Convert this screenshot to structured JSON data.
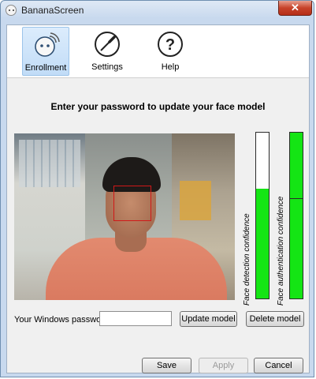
{
  "window": {
    "title": "BananaScreen",
    "close_glyph": "✕"
  },
  "toolbar": {
    "items": [
      {
        "label": "Enrollment",
        "icon": "enrollment-face-icon",
        "active": true
      },
      {
        "label": "Settings",
        "icon": "screwdriver-icon",
        "active": false
      },
      {
        "label": "Help",
        "icon": "question-mark-icon",
        "active": false
      }
    ]
  },
  "main": {
    "heading": "Enter your password to update your face model",
    "camera": {
      "face_box_color": "#d01818"
    },
    "meters": [
      {
        "label": "Face detection confidence",
        "level": 0.66,
        "color": "#14e514"
      },
      {
        "label": "Face authentication confidence",
        "level": 1.0,
        "marker": 0.6,
        "color": "#14e514"
      }
    ],
    "password": {
      "label": "Your Windows password:",
      "value": "",
      "update_button": "Update model",
      "delete_button": "Delete model"
    }
  },
  "footer": {
    "save": "Save",
    "apply": "Apply",
    "cancel": "Cancel"
  }
}
